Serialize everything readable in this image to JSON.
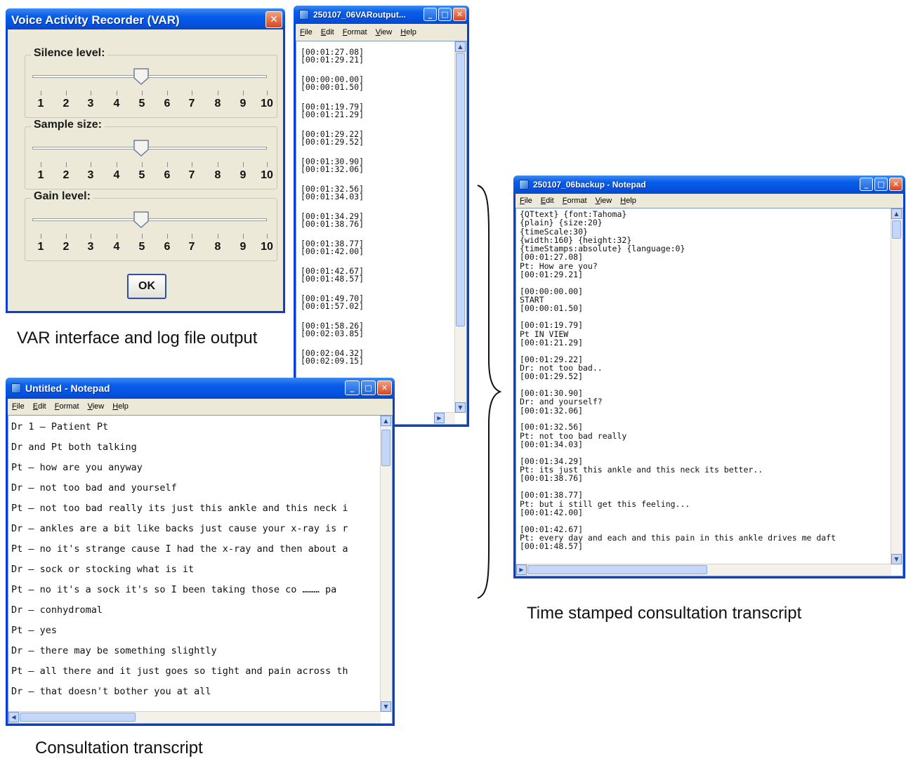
{
  "var_dialog": {
    "title": "Voice Activity Recorder (VAR)",
    "close_label": "✕",
    "groups": [
      {
        "label": "Silence level:",
        "value": 5
      },
      {
        "label": "Sample size:",
        "value": 5
      },
      {
        "label": "Gain level:",
        "value": 5
      }
    ],
    "scale": [
      "1",
      "2",
      "3",
      "4",
      "5",
      "6",
      "7",
      "8",
      "9",
      "10"
    ],
    "ok_label": "OK"
  },
  "log_window": {
    "title": "250107_06VARoutput...",
    "menu": [
      "File",
      "Edit",
      "Format",
      "View",
      "Help"
    ],
    "entries": [
      [
        "[00:01:27.08]",
        "[00:01:29.21]"
      ],
      [
        "[00:00:00.00]",
        "[00:00:01.50]"
      ],
      [
        "[00:01:19.79]",
        "[00:01:21.29]"
      ],
      [
        "[00:01:29.22]",
        "[00:01:29.52]"
      ],
      [
        "[00:01:30.90]",
        "[00:01:32.06]"
      ],
      [
        "[00:01:32.56]",
        "[00:01:34.03]"
      ],
      [
        "[00:01:34.29]",
        "[00:01:38.76]"
      ],
      [
        "[00:01:38.77]",
        "[00:01:42.00]"
      ],
      [
        "[00:01:42.67]",
        "[00:01:48.57]"
      ],
      [
        "[00:01:49.70]",
        "[00:01:57.02]"
      ],
      [
        "[00:01:58.26]",
        "[00:02:03.85]"
      ],
      [
        "[00:02:04.32]",
        "[00:02:09.15]"
      ]
    ]
  },
  "transcript_window": {
    "title": "Untitled - Notepad",
    "menu": [
      "File",
      "Edit",
      "Format",
      "View",
      "Help"
    ],
    "lines": [
      "Dr 1 – Patient Pt",
      "Dr and Pt both talking",
      "Pt – how are you anyway",
      "Dr – not too bad and yourself",
      "Pt – not too bad really its just this ankle and this neck i",
      "Dr – ankles are a bit like backs just cause your x-ray is r",
      "Pt – no it's strange cause I had the x-ray and then about a",
      "Dr – sock or stocking what is it",
      "Pt – no it's a sock it's so I been taking those co ……… pa",
      "Dr – conhydromal",
      "Pt – yes",
      "Dr – there may be something slightly",
      "Pt – all there and it just goes so tight and pain across th",
      "Dr – that doesn't bother you at all"
    ]
  },
  "backup_window": {
    "title": "250107_06backup - Notepad",
    "menu": [
      "File",
      "Edit",
      "Format",
      "View",
      "Help"
    ],
    "lines": [
      "{QTtext} {font:Tahoma}",
      "{plain} {size:20}",
      "{timeScale:30}",
      "{width:160} {height:32}",
      "{timeStamps:absolute} {language:0}",
      "[00:01:27.08]",
      "Pt: How are you?",
      "[00:01:29.21]",
      "",
      "[00:00:00.00]",
      "START",
      "[00:00:01.50]",
      "",
      "[00:01:19.79]",
      "Pt IN VIEW",
      "[00:01:21.29]",
      "",
      "[00:01:29.22]",
      "Dr: not too bad..",
      "[00:01:29.52]",
      "",
      "[00:01:30.90]",
      "Dr: and yourself?",
      "[00:01:32.06]",
      "",
      "[00:01:32.56]",
      "Pt: not too bad really",
      "[00:01:34.03]",
      "",
      "[00:01:34.29]",
      "Pt: its just this ankle and this neck its better..",
      "[00:01:38.76]",
      "",
      "[00:01:38.77]",
      "Pt: but i still get this feeling...",
      "[00:01:42.00]",
      "",
      "[00:01:42.67]",
      "Pt: every day and each and this pain in this ankle drives me daft",
      "[00:01:48.57]"
    ]
  },
  "captions": {
    "var": "VAR interface and log file output",
    "consultation": "Consultation transcript",
    "timestamped": "Time stamped consultation transcript"
  },
  "colors": {
    "titlebar": "#0554e3",
    "window_border": "#0a3fd1",
    "window_bg": "#ece9d8",
    "close_button": "#d8461c"
  }
}
